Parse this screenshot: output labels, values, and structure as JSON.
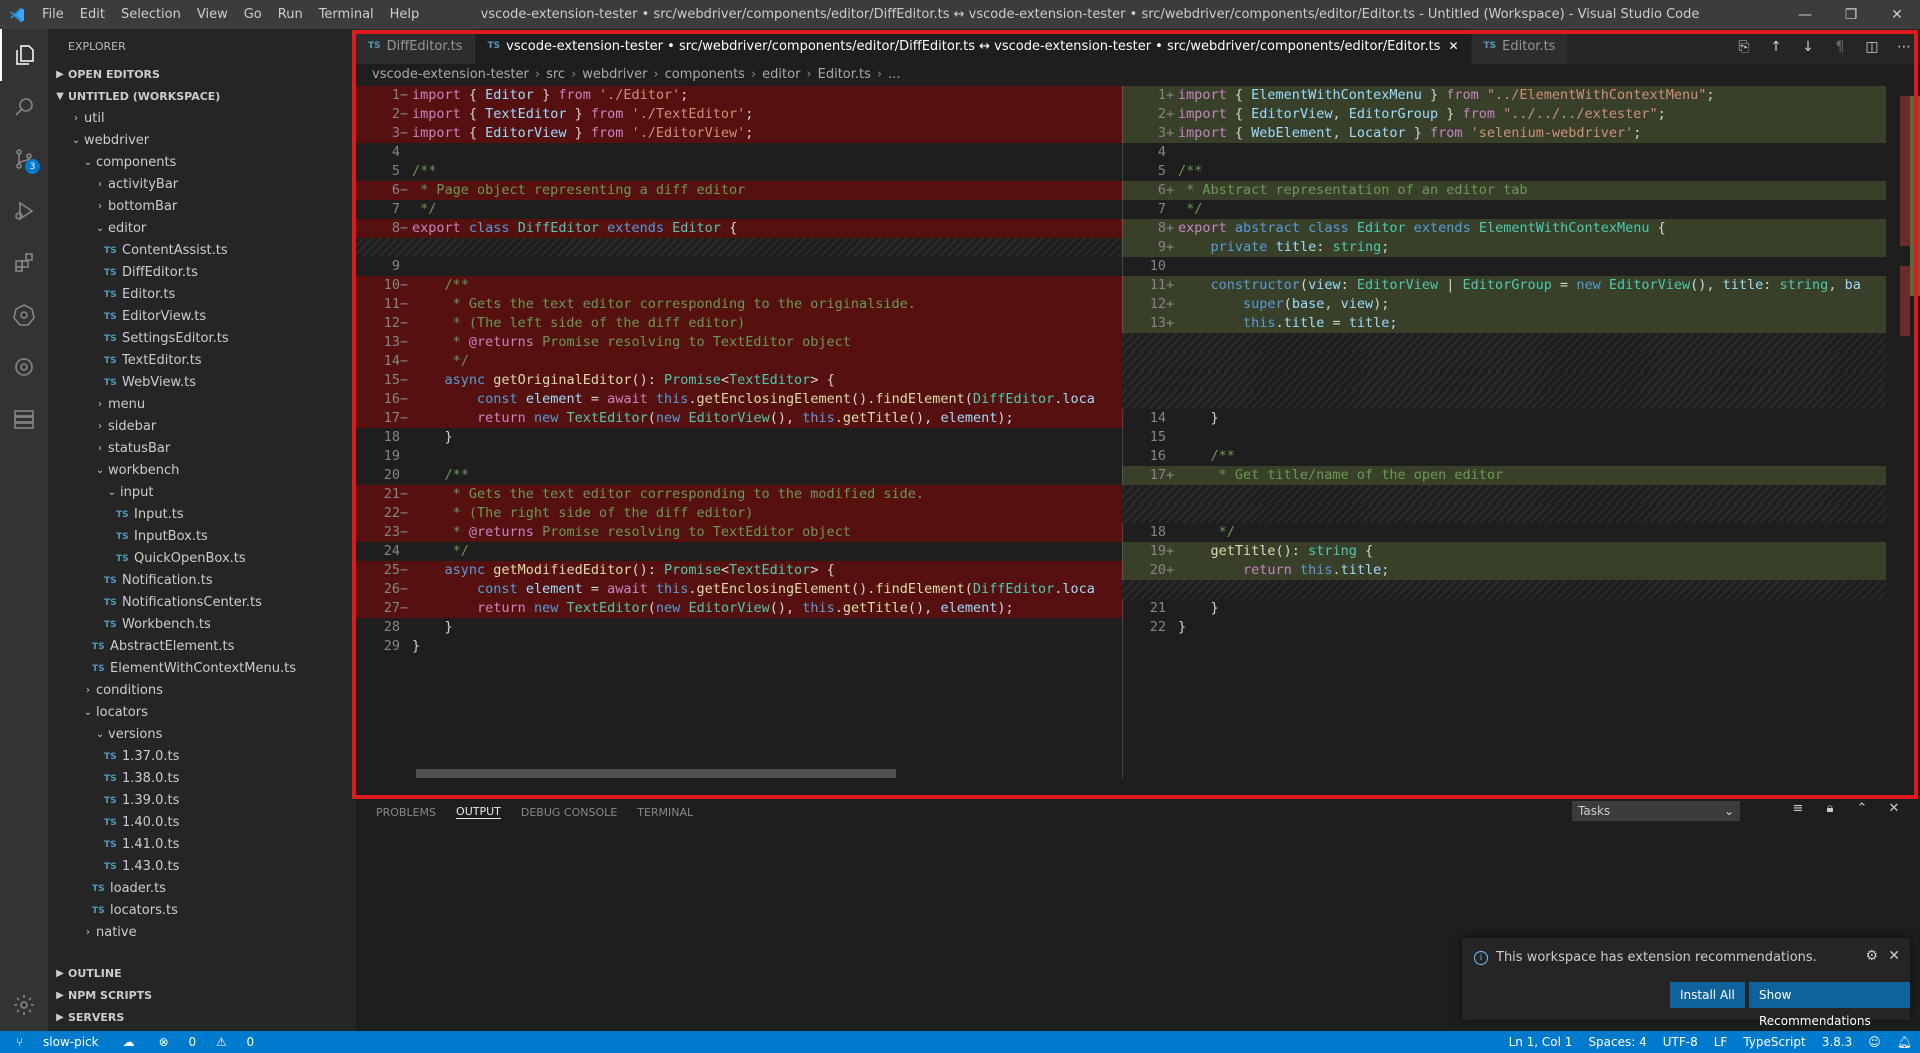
{
  "titlebar": {
    "menu": [
      "File",
      "Edit",
      "Selection",
      "View",
      "Go",
      "Run",
      "Terminal",
      "Help"
    ],
    "title": "vscode-extension-tester • src/webdriver/components/editor/DiffEditor.ts ↔ vscode-extension-tester • src/webdriver/components/editor/Editor.ts - Untitled (Workspace) - Visual Studio Code"
  },
  "activity": {
    "scm_badge": "3"
  },
  "sidebar": {
    "title": "EXPLORER",
    "open_editors": "OPEN EDITORS",
    "workspace": "UNTITLED (WORKSPACE)",
    "tree": [
      {
        "label": "util",
        "kind": "folder",
        "open": false,
        "depth": 1
      },
      {
        "label": "webdriver",
        "kind": "folder",
        "open": true,
        "depth": 1
      },
      {
        "label": "components",
        "kind": "folder",
        "open": true,
        "depth": 2
      },
      {
        "label": "activityBar",
        "kind": "folder",
        "open": false,
        "depth": 3
      },
      {
        "label": "bottomBar",
        "kind": "folder",
        "open": false,
        "depth": 3
      },
      {
        "label": "editor",
        "kind": "folder",
        "open": true,
        "depth": 3
      },
      {
        "label": "ContentAssist.ts",
        "kind": "file",
        "depth": 4
      },
      {
        "label": "DiffEditor.ts",
        "kind": "file",
        "depth": 4
      },
      {
        "label": "Editor.ts",
        "kind": "file",
        "depth": 4
      },
      {
        "label": "EditorView.ts",
        "kind": "file",
        "depth": 4
      },
      {
        "label": "SettingsEditor.ts",
        "kind": "file",
        "depth": 4
      },
      {
        "label": "TextEditor.ts",
        "kind": "file",
        "depth": 4
      },
      {
        "label": "WebView.ts",
        "kind": "file",
        "depth": 4
      },
      {
        "label": "menu",
        "kind": "folder",
        "open": false,
        "depth": 3
      },
      {
        "label": "sidebar",
        "kind": "folder",
        "open": false,
        "depth": 3
      },
      {
        "label": "statusBar",
        "kind": "folder",
        "open": false,
        "depth": 3
      },
      {
        "label": "workbench",
        "kind": "folder",
        "open": true,
        "depth": 3
      },
      {
        "label": "input",
        "kind": "folder",
        "open": true,
        "depth": 4
      },
      {
        "label": "Input.ts",
        "kind": "file",
        "depth": 5
      },
      {
        "label": "InputBox.ts",
        "kind": "file",
        "depth": 5
      },
      {
        "label": "QuickOpenBox.ts",
        "kind": "file",
        "depth": 5
      },
      {
        "label": "Notification.ts",
        "kind": "file",
        "depth": 4
      },
      {
        "label": "NotificationsCenter.ts",
        "kind": "file",
        "depth": 4
      },
      {
        "label": "Workbench.ts",
        "kind": "file",
        "depth": 4
      },
      {
        "label": "AbstractElement.ts",
        "kind": "file",
        "depth": 3
      },
      {
        "label": "ElementWithContextMenu.ts",
        "kind": "file",
        "depth": 3
      },
      {
        "label": "conditions",
        "kind": "folder",
        "open": false,
        "depth": 2
      },
      {
        "label": "locators",
        "kind": "folder",
        "open": true,
        "depth": 2
      },
      {
        "label": "versions",
        "kind": "folder",
        "open": true,
        "depth": 3
      },
      {
        "label": "1.37.0.ts",
        "kind": "file",
        "depth": 4
      },
      {
        "label": "1.38.0.ts",
        "kind": "file",
        "depth": 4
      },
      {
        "label": "1.39.0.ts",
        "kind": "file",
        "depth": 4
      },
      {
        "label": "1.40.0.ts",
        "kind": "file",
        "depth": 4
      },
      {
        "label": "1.41.0.ts",
        "kind": "file",
        "depth": 4
      },
      {
        "label": "1.43.0.ts",
        "kind": "file",
        "depth": 4
      },
      {
        "label": "loader.ts",
        "kind": "file",
        "depth": 3
      },
      {
        "label": "locators.ts",
        "kind": "file",
        "depth": 3
      },
      {
        "label": "native",
        "kind": "folder",
        "open": false,
        "depth": 2
      }
    ],
    "outline": "OUTLINE",
    "npm": "NPM SCRIPTS",
    "servers": "SERVERS"
  },
  "tabs": [
    {
      "label": "DiffEditor.ts",
      "active": false
    },
    {
      "label": "vscode-extension-tester • src/webdriver/components/editor/DiffEditor.ts ↔ vscode-extension-tester • src/webdriver/components/editor/Editor.ts",
      "active": true
    },
    {
      "label": "Editor.ts",
      "active": false
    }
  ],
  "breadcrumbs": [
    "vscode-extension-tester",
    "src",
    "webdriver",
    "components",
    "editor",
    "Editor.ts",
    "..."
  ],
  "left_lines": [
    {
      "n": "1",
      "m": "−",
      "cls": "del",
      "h": "<span class='c'>import</span> { <span class='v'>Editor</span> } <span class='c'>from</span> <span class='s'>'./Editor'</span>;"
    },
    {
      "n": "2",
      "m": "−",
      "cls": "del",
      "h": "<span class='c'>import</span> { <span class='v'>TextEditor</span> } <span class='c'>from</span> <span class='s'>'./TextEditor'</span>;"
    },
    {
      "n": "3",
      "m": "−",
      "cls": "del",
      "h": "<span class='c'>import</span> { <span class='v'>EditorView</span> } <span class='c'>from</span> <span class='s'>'./EditorView'</span>;"
    },
    {
      "n": "4",
      "m": "",
      "cls": "",
      "h": ""
    },
    {
      "n": "5",
      "m": "",
      "cls": "",
      "h": "<span class='cm'>/**</span>"
    },
    {
      "n": "6",
      "m": "−",
      "cls": "del",
      "h": "<span class='cm'> * Page object representing a diff editor</span>"
    },
    {
      "n": "7",
      "m": "",
      "cls": "",
      "h": "<span class='cm'> */</span>"
    },
    {
      "n": "8",
      "m": "−",
      "cls": "del",
      "h": "<span class='c'>export</span> <span class='k'>class</span> <span class='t'>DiffEditor</span> <span class='k'>extends</span> <span class='t'>Editor</span> {"
    },
    {
      "n": "",
      "m": "",
      "cls": "gap",
      "h": ""
    },
    {
      "n": "9",
      "m": "",
      "cls": "",
      "h": ""
    },
    {
      "n": "10",
      "m": "−",
      "cls": "del",
      "h": "    <span class='cm'>/**</span>"
    },
    {
      "n": "11",
      "m": "−",
      "cls": "del",
      "h": "<span class='cm'>     * Gets the text editor corresponding to the originalside.</span>"
    },
    {
      "n": "12",
      "m": "−",
      "cls": "del",
      "h": "<span class='cm'>     * (The left side of the diff editor)</span>"
    },
    {
      "n": "13",
      "m": "−",
      "cls": "del",
      "h": "<span class='cm'>     * <span class='c'>@returns</span> Promise resolving to TextEditor object</span>"
    },
    {
      "n": "14",
      "m": "−",
      "cls": "del",
      "h": "<span class='cm'>     */</span>"
    },
    {
      "n": "15",
      "m": "−",
      "cls": "del",
      "h": "    <span class='k'>async</span> <span class='f'>getOriginalEditor</span>(): <span class='t'>Promise</span>&lt;<span class='t'>TextEditor</span>&gt; {"
    },
    {
      "n": "16",
      "m": "−",
      "cls": "del",
      "h": "        <span class='k'>const</span> <span class='v'>element</span> = <span class='c'>await</span> <span class='k'>this</span>.<span class='f'>getEnclosingElement</span>().<span class='f'>findElement</span>(<span class='t'>DiffEditor</span>.<span class='v'>loca</span>"
    },
    {
      "n": "17",
      "m": "−",
      "cls": "del",
      "h": "        <span class='c'>return</span> <span class='k'>new</span> <span class='t'>TextEditor</span>(<span class='k'>new</span> <span class='t'>EditorView</span>(), <span class='k'>this</span>.<span class='f'>getTitle</span>(), <span class='v'>element</span>);"
    },
    {
      "n": "18",
      "m": "",
      "cls": "",
      "h": "    }"
    },
    {
      "n": "19",
      "m": "",
      "cls": "",
      "h": ""
    },
    {
      "n": "20",
      "m": "",
      "cls": "",
      "h": "    <span class='cm'>/**</span>"
    },
    {
      "n": "21",
      "m": "−",
      "cls": "del",
      "h": "<span class='cm'>     * Gets the text editor corresponding to the modified side.</span>"
    },
    {
      "n": "22",
      "m": "−",
      "cls": "del",
      "h": "<span class='cm'>     * (The right side of the diff editor)</span>"
    },
    {
      "n": "23",
      "m": "−",
      "cls": "del",
      "h": "<span class='cm'>     * <span class='c'>@returns</span> Promise resolving to TextEditor object</span>"
    },
    {
      "n": "24",
      "m": "",
      "cls": "",
      "h": "<span class='cm'>     */</span>"
    },
    {
      "n": "25",
      "m": "−",
      "cls": "del",
      "h": "    <span class='k'>async</span> <span class='f'>getModifiedEditor</span>(): <span class='t'>Promise</span>&lt;<span class='t'>TextEditor</span>&gt; {"
    },
    {
      "n": "26",
      "m": "−",
      "cls": "del",
      "h": "        <span class='k'>const</span> <span class='v'>element</span> = <span class='c'>await</span> <span class='k'>this</span>.<span class='f'>getEnclosingElement</span>().<span class='f'>findElement</span>(<span class='t'>DiffEditor</span>.<span class='v'>loca</span>"
    },
    {
      "n": "27",
      "m": "−",
      "cls": "del",
      "h": "        <span class='c'>return</span> <span class='k'>new</span> <span class='t'>TextEditor</span>(<span class='k'>new</span> <span class='t'>EditorView</span>(), <span class='k'>this</span>.<span class='f'>getTitle</span>(), <span class='v'>element</span>);"
    },
    {
      "n": "28",
      "m": "",
      "cls": "",
      "h": "    }"
    },
    {
      "n": "29",
      "m": "",
      "cls": "",
      "h": "}"
    }
  ],
  "right_lines": [
    {
      "n": "1",
      "m": "+",
      "cls": "ins",
      "h": "<span class='c'>import</span> { <span class='v'>ElementWithContexMenu</span> } <span class='c'>from</span> <span class='s'>\"../ElementWithContextMenu\"</span>;"
    },
    {
      "n": "2",
      "m": "+",
      "cls": "ins",
      "h": "<span class='c'>import</span> { <span class='v'>EditorView</span>, <span class='v'>EditorGroup</span> } <span class='c'>from</span> <span class='s'>\"../../../extester\"</span>;"
    },
    {
      "n": "3",
      "m": "+",
      "cls": "ins",
      "h": "<span class='c'>import</span> { <span class='v'>WebElement</span>, <span class='v'>Locator</span> } <span class='c'>from</span> <span class='s'>'selenium-webdriver'</span>;"
    },
    {
      "n": "4",
      "m": "",
      "cls": "",
      "h": ""
    },
    {
      "n": "5",
      "m": "",
      "cls": "",
      "h": "<span class='cm'>/**</span>"
    },
    {
      "n": "6",
      "m": "+",
      "cls": "ins",
      "h": "<span class='cm'> * Abstract representation of an editor tab</span>"
    },
    {
      "n": "7",
      "m": "",
      "cls": "",
      "h": "<span class='cm'> */</span>"
    },
    {
      "n": "8",
      "m": "+",
      "cls": "ins",
      "h": "<span class='c'>export</span> <span class='k'>abstract</span> <span class='k'>class</span> <span class='t'>Editor</span> <span class='k'>extends</span> <span class='t'>ElementWithContexMenu</span> {"
    },
    {
      "n": "9",
      "m": "+",
      "cls": "ins",
      "h": "    <span class='k'>private</span> <span class='v'>title</span>: <span class='t'>string</span>;"
    },
    {
      "n": "10",
      "m": "",
      "cls": "",
      "h": ""
    },
    {
      "n": "11",
      "m": "+",
      "cls": "ins",
      "h": "    <span class='k'>constructor</span>(<span class='v'>view</span>: <span class='t'>EditorView</span> | <span class='t'>EditorGroup</span> = <span class='k'>new</span> <span class='t'>EditorView</span>(), <span class='v'>title</span>: <span class='t'>string</span>, <span class='v'>ba</span>"
    },
    {
      "n": "12",
      "m": "+",
      "cls": "ins",
      "h": "        <span class='k'>super</span>(<span class='v'>base</span>, <span class='v'>view</span>);"
    },
    {
      "n": "13",
      "m": "+",
      "cls": "ins",
      "h": "        <span class='k'>this</span>.<span class='v'>title</span> = <span class='v'>title</span>;"
    },
    {
      "n": "",
      "m": "",
      "cls": "gap",
      "h": ""
    },
    {
      "n": "",
      "m": "",
      "cls": "gap",
      "h": ""
    },
    {
      "n": "",
      "m": "",
      "cls": "gap",
      "h": ""
    },
    {
      "n": "",
      "m": "",
      "cls": "gap",
      "h": ""
    },
    {
      "n": "14",
      "m": "",
      "cls": "",
      "h": "    }"
    },
    {
      "n": "15",
      "m": "",
      "cls": "",
      "h": ""
    },
    {
      "n": "16",
      "m": "",
      "cls": "",
      "h": "    <span class='cm'>/**</span>"
    },
    {
      "n": "17",
      "m": "+",
      "cls": "ins",
      "h": "<span class='cm'>     * Get title/name of the open editor</span>"
    },
    {
      "n": "",
      "m": "",
      "cls": "gap",
      "h": ""
    },
    {
      "n": "",
      "m": "",
      "cls": "gap",
      "h": ""
    },
    {
      "n": "18",
      "m": "",
      "cls": "",
      "h": "<span class='cm'>     */</span>"
    },
    {
      "n": "19",
      "m": "+",
      "cls": "ins",
      "h": "    <span class='f'>getTitle</span>(): <span class='t'>string</span> {"
    },
    {
      "n": "20",
      "m": "+",
      "cls": "ins",
      "h": "        <span class='c'>return</span> <span class='k'>this</span>.<span class='v'>title</span>;"
    },
    {
      "n": "",
      "m": "",
      "cls": "gap",
      "h": ""
    },
    {
      "n": "21",
      "m": "",
      "cls": "",
      "h": "    }"
    },
    {
      "n": "22",
      "m": "",
      "cls": "",
      "h": "}"
    }
  ],
  "panel": {
    "tabs": [
      "PROBLEMS",
      "OUTPUT",
      "DEBUG CONSOLE",
      "TERMINAL"
    ],
    "active_tab": "OUTPUT",
    "task_select": "Tasks"
  },
  "notification": {
    "message": "This workspace has extension recommendations.",
    "install_all": "Install All",
    "show_recs": "Show Recommendations"
  },
  "statusbar": {
    "branch": "slow-pick",
    "errors": "0",
    "warnings": "0",
    "position": "Ln 1, Col 1",
    "spaces": "Spaces: 4",
    "encoding": "UTF-8",
    "eol": "LF",
    "language": "TypeScript",
    "version": "3.8.3"
  },
  "colors": {
    "accent": "#007acc",
    "highlight_border": "#e0191c",
    "deleted": "#9b0000",
    "inserted": "#9bb955"
  }
}
